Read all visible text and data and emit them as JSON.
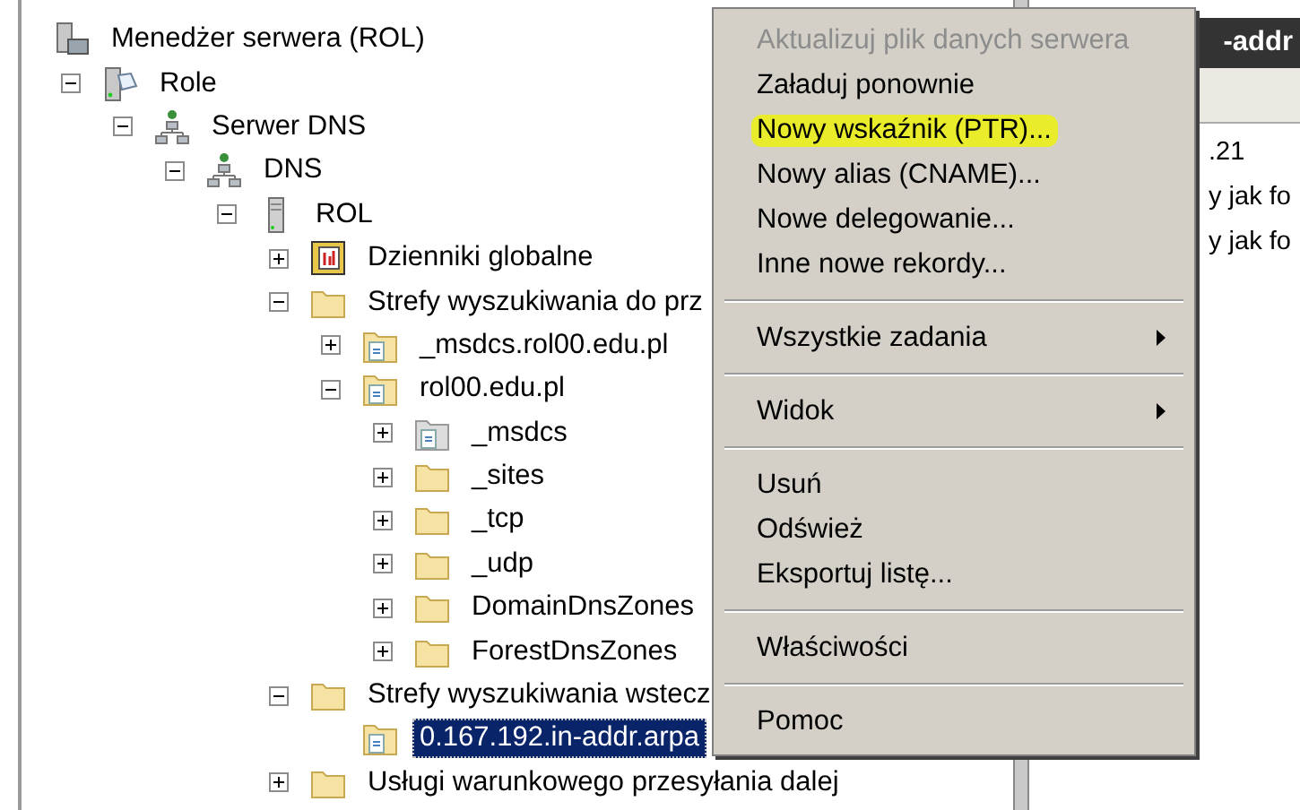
{
  "tree": [
    {
      "label": "Menedżer serwera (ROL)",
      "kind": "server-manager",
      "selected": false,
      "children": [
        {
          "label": "Role",
          "kind": "roles",
          "expanded": true,
          "selected": false,
          "children": [
            {
              "label": "Serwer DNS",
              "kind": "network",
              "expanded": true,
              "selected": false,
              "children": [
                {
                  "label": "DNS",
                  "kind": "network",
                  "expanded": true,
                  "selected": false,
                  "children": [
                    {
                      "label": "ROL",
                      "kind": "server",
                      "expanded": true,
                      "selected": false,
                      "children": [
                        {
                          "label": "Dzienniki globalne",
                          "kind": "log",
                          "expanded": false,
                          "selected": false
                        },
                        {
                          "label": "Strefy wyszukiwania do prz",
                          "kind": "folder",
                          "expanded": true,
                          "selected": false,
                          "children": [
                            {
                              "label": "_msdcs.rol00.edu.pl",
                              "kind": "zone",
                              "expanded": false,
                              "selected": false
                            },
                            {
                              "label": "rol00.edu.pl",
                              "kind": "zone",
                              "expanded": true,
                              "selected": false,
                              "children": [
                                {
                                  "label": "_msdcs",
                                  "kind": "inactive-zone",
                                  "expanded": false,
                                  "selected": false
                                },
                                {
                                  "label": "_sites",
                                  "kind": "folder",
                                  "expanded": false,
                                  "selected": false
                                },
                                {
                                  "label": "_tcp",
                                  "kind": "folder",
                                  "expanded": false,
                                  "selected": false
                                },
                                {
                                  "label": "_udp",
                                  "kind": "folder",
                                  "expanded": false,
                                  "selected": false
                                },
                                {
                                  "label": "DomainDnsZones",
                                  "kind": "folder",
                                  "expanded": false,
                                  "selected": false
                                },
                                {
                                  "label": "ForestDnsZones",
                                  "kind": "folder",
                                  "expanded": false,
                                  "selected": false
                                }
                              ]
                            }
                          ]
                        },
                        {
                          "label": "Strefy wyszukiwania wstecz",
                          "kind": "folder",
                          "expanded": true,
                          "selected": false,
                          "children": [
                            {
                              "label": "0.167.192.in-addr.arpa",
                              "kind": "zone",
                              "selected": true
                            }
                          ]
                        },
                        {
                          "label": "Usługi warunkowego przesyłania dalej",
                          "kind": "folder",
                          "expanded": false,
                          "selected": false
                        }
                      ]
                    }
                  ]
                }
              ]
            }
          ]
        }
      ]
    }
  ],
  "details_pane": {
    "title": "-addr",
    "rows": [
      ".21",
      "y jak fo",
      "y jak fo"
    ]
  },
  "context_menu": [
    {
      "kind": "item",
      "label": "Aktualizuj plik danych serwera",
      "disabled": true,
      "highlighted": false
    },
    {
      "kind": "item",
      "label": "Załaduj ponownie",
      "disabled": false,
      "highlighted": false
    },
    {
      "kind": "item",
      "label": "Nowy wskaźnik (PTR)...",
      "disabled": false,
      "highlighted": true
    },
    {
      "kind": "item",
      "label": "Nowy alias (CNAME)...",
      "disabled": false,
      "highlighted": false
    },
    {
      "kind": "item",
      "label": "Nowe delegowanie...",
      "disabled": false,
      "highlighted": false
    },
    {
      "kind": "item",
      "label": "Inne nowe rekordy...",
      "disabled": false,
      "highlighted": false
    },
    {
      "kind": "separator"
    },
    {
      "kind": "submenu",
      "label": "Wszystkie zadania",
      "disabled": false,
      "highlighted": false
    },
    {
      "kind": "separator"
    },
    {
      "kind": "submenu",
      "label": "Widok",
      "disabled": false,
      "highlighted": false
    },
    {
      "kind": "separator"
    },
    {
      "kind": "item",
      "label": "Usuń",
      "disabled": false,
      "highlighted": false
    },
    {
      "kind": "item",
      "label": "Odśwież",
      "disabled": false,
      "highlighted": false
    },
    {
      "kind": "item",
      "label": "Eksportuj listę...",
      "disabled": false,
      "highlighted": false
    },
    {
      "kind": "separator"
    },
    {
      "kind": "item",
      "label": "Właściwości",
      "disabled": false,
      "highlighted": false
    },
    {
      "kind": "separator"
    },
    {
      "kind": "item",
      "label": "Pomoc",
      "disabled": false,
      "highlighted": false
    }
  ]
}
